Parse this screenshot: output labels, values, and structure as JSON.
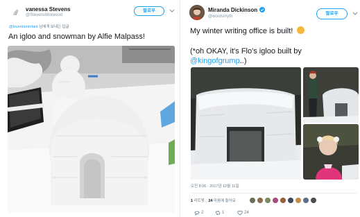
{
  "tweet1": {
    "name": "vanessa Stevens",
    "handle": "@StevensWorwood",
    "follow_label": "팔로우",
    "reply_handle": "@InventionInfant",
    "reply_suffix": " 님에게 보내는 답글",
    "text": "An igloo and snowman by Alfie Malpass!"
  },
  "tweet2": {
    "name": "Miranda Dickinson",
    "handle": "@wordsmyth",
    "follow_label": "팔로우",
    "text_line1": "My winter writing office is built!",
    "emoji": "☺",
    "text_line2": "(*oh OKAY, it's Flo's igloo built by",
    "mention": "@kingofgrump",
    "text_line3_suffix": "..)",
    "timestamp": "오전 8:06 - 2017년 12월 11일",
    "retweets_count": "1",
    "retweets_label": "리트윗",
    "likes_count": "24",
    "likes_label": "마음에 들어요",
    "reply_count": "2",
    "retweet_count": "1",
    "like_count": "24"
  },
  "colors": {
    "accent": "#1da1f2",
    "verified": "#1da1f2",
    "muted": "#657786",
    "emoji": "#f5b93a"
  }
}
